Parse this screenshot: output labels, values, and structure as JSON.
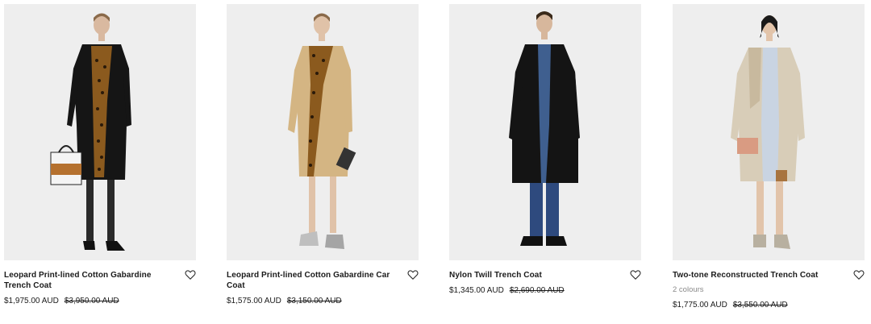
{
  "products": [
    {
      "name": "Leopard Print-lined Cotton Gabardine Trench Coat",
      "colours": "",
      "price": "$1,975.00 AUD",
      "was_price": "$3,950.00 AUD",
      "wishlist_icon": "heart-outline"
    },
    {
      "name": "Leopard Print-lined Cotton Gabardine Car Coat",
      "colours": "",
      "price": "$1,575.00 AUD",
      "was_price": "$3,150.00 AUD",
      "wishlist_icon": "heart-outline"
    },
    {
      "name": "Nylon Twill Trench Coat",
      "colours": "",
      "price": "$1,345.00 AUD",
      "was_price": "$2,690.00 AUD",
      "wishlist_icon": "heart-outline"
    },
    {
      "name": "Two-tone Reconstructed Trench Coat",
      "colours": "2 colours",
      "price": "$1,775.00 AUD",
      "was_price": "$3,550.00 AUD",
      "wishlist_icon": "heart-outline"
    }
  ]
}
